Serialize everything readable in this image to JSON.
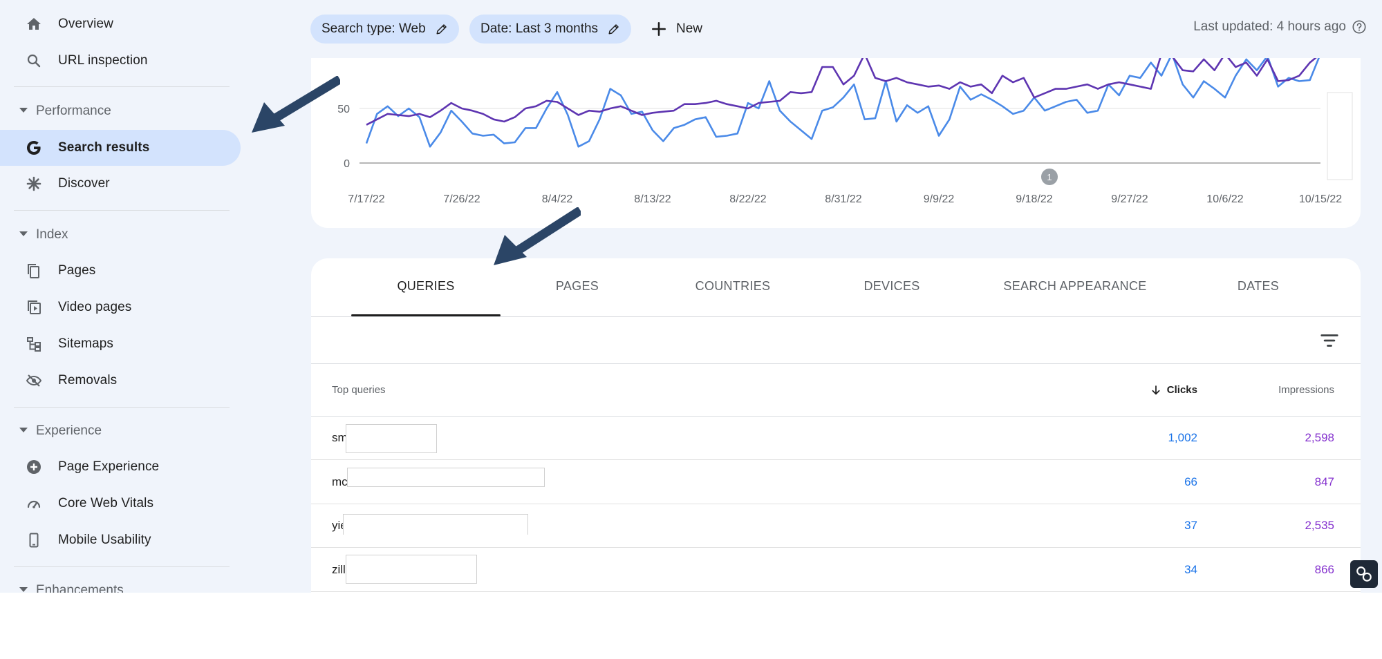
{
  "sidebar": {
    "top_items": [
      {
        "label": "Overview",
        "icon": "home-icon"
      },
      {
        "label": "URL inspection",
        "icon": "search-icon"
      }
    ],
    "sections": [
      {
        "title": "Performance",
        "items": [
          {
            "label": "Search results",
            "icon": "google-g-icon",
            "active": true
          },
          {
            "label": "Discover",
            "icon": "asterisk-icon"
          }
        ]
      },
      {
        "title": "Index",
        "items": [
          {
            "label": "Pages",
            "icon": "pages-icon"
          },
          {
            "label": "Video pages",
            "icon": "video-pages-icon"
          },
          {
            "label": "Sitemaps",
            "icon": "sitemap-icon"
          },
          {
            "label": "Removals",
            "icon": "eye-off-icon"
          }
        ]
      },
      {
        "title": "Experience",
        "items": [
          {
            "label": "Page Experience",
            "icon": "plus-circle-icon"
          },
          {
            "label": "Core Web Vitals",
            "icon": "speedometer-icon"
          },
          {
            "label": "Mobile Usability",
            "icon": "phone-icon"
          }
        ]
      },
      {
        "title": "Enhancements",
        "items": []
      }
    ]
  },
  "toolbar": {
    "chips": [
      {
        "label": "Search type: Web"
      },
      {
        "label": "Date: Last 3 months"
      }
    ],
    "new_label": "New",
    "last_updated": "Last updated: 4 hours ago"
  },
  "chart_data": {
    "type": "line",
    "x_tick_labels": [
      "7/17/22",
      "7/26/22",
      "8/4/22",
      "8/13/22",
      "8/22/22",
      "8/31/22",
      "9/9/22",
      "9/18/22",
      "9/27/22",
      "10/6/22",
      "10/15/22"
    ],
    "y_tick_labels": [
      "0",
      "50"
    ],
    "ylim": [
      0,
      100
    ],
    "grid": true,
    "annotation_marker": "1",
    "series": [
      {
        "color": "#4a8ae8",
        "values": [
          18,
          45,
          52,
          43,
          50,
          42,
          15,
          28,
          48,
          38,
          27,
          25,
          26,
          18,
          19,
          32,
          32,
          50,
          65,
          44,
          15,
          20,
          40,
          68,
          62,
          45,
          47,
          30,
          20,
          32,
          35,
          40,
          42,
          24,
          25,
          27,
          55,
          50,
          75,
          48,
          38,
          30,
          22,
          48,
          51,
          60,
          72,
          40,
          41,
          75,
          38,
          53,
          46,
          52,
          25,
          40,
          70,
          58,
          63,
          58,
          52,
          45,
          48,
          60,
          48,
          52,
          56,
          58,
          46,
          48,
          72,
          62,
          80,
          78,
          92,
          80,
          100,
          72,
          60,
          75,
          68,
          60,
          80,
          95,
          85,
          98,
          70,
          78,
          75,
          76,
          100
        ]
      },
      {
        "color": "#5e35b1",
        "values": [
          35,
          40,
          45,
          44,
          43,
          45,
          42,
          48,
          55,
          50,
          48,
          45,
          40,
          38,
          42,
          50,
          52,
          57,
          56,
          50,
          44,
          48,
          47,
          50,
          52,
          48,
          44,
          46,
          47,
          48,
          54,
          54,
          55,
          57,
          54,
          52,
          50,
          55,
          56,
          57,
          65,
          64,
          65,
          88,
          88,
          72,
          80,
          100,
          78,
          75,
          78,
          74,
          72,
          70,
          71,
          68,
          74,
          70,
          72,
          64,
          80,
          74,
          78,
          60,
          64,
          68,
          68,
          70,
          72,
          68,
          72,
          74,
          72,
          70,
          68,
          100,
          98,
          85,
          84,
          95,
          85,
          100,
          88,
          92,
          80,
          95,
          75,
          76,
          80,
          92,
          100
        ]
      }
    ]
  },
  "table": {
    "tabs": [
      "QUERIES",
      "PAGES",
      "COUNTRIES",
      "DEVICES",
      "SEARCH APPEARANCE",
      "DATES"
    ],
    "active_tab": "QUERIES",
    "headers": {
      "query": "Top queries",
      "clicks": "Clicks",
      "impressions": "Impressions"
    },
    "rows": [
      {
        "query": "sm",
        "clicks": "1,002",
        "impressions": "2,598"
      },
      {
        "query": "mc",
        "clicks": "66",
        "impressions": "847"
      },
      {
        "query": "yie",
        "clicks": "37",
        "impressions": "2,535"
      },
      {
        "query": "zill",
        "clicks": "34",
        "impressions": "866"
      }
    ]
  },
  "colors": {
    "accent": "#1a73e8",
    "impressions": "#8430ce",
    "active_nav": "#d3e3fd",
    "arrow": "#2b4566"
  }
}
